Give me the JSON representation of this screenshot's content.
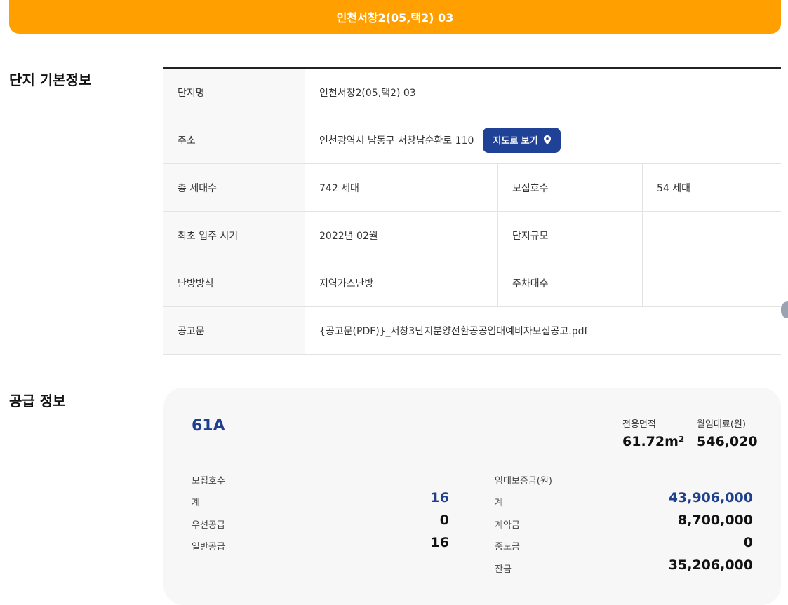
{
  "banner": {
    "title": "인천서창2(05,택2) 03"
  },
  "basic_info": {
    "section_title": "단지 기본정보",
    "rows": {
      "name": {
        "label": "단지명",
        "value": "인천서창2(05,택2) 03"
      },
      "address": {
        "label": "주소",
        "value": "인천광역시 남동구 서창남순환로 110",
        "map_button": "지도로 보기"
      },
      "households": {
        "label": "총 세대수",
        "value": "742 세대",
        "label2": "모집호수",
        "value2": "54 세대"
      },
      "move_in": {
        "label": "최초 입주 시기",
        "value": "2022년 02월",
        "label2": "단지규모",
        "value2": ""
      },
      "heating": {
        "label": "난방방식",
        "value": "지역가스난방",
        "label2": "주차대수",
        "value2": ""
      },
      "notice": {
        "label": "공고문",
        "value": "{공고문(PDF)}_서창3단지분양전환공공임대예비자모집공고.pdf"
      }
    }
  },
  "supply_info": {
    "section_title": "공급 정보",
    "type_name": "61A",
    "area_label": "전용면적",
    "area_value": "61.72m²",
    "rent_label": "월임대료(원)",
    "rent_value": "546,020",
    "recruit": {
      "title": "모집호수",
      "total_label": "계",
      "total_value": "16",
      "priority_label": "우선공급",
      "priority_value": "0",
      "general_label": "일반공급",
      "general_value": "16"
    },
    "deposit": {
      "title": "임대보증금(원)",
      "total_label": "계",
      "total_value": "43,906,000",
      "contract_label": "계약금",
      "contract_value": "8,700,000",
      "middle_label": "중도금",
      "middle_value": "0",
      "balance_label": "잔금",
      "balance_value": "35,206,000"
    }
  },
  "colors": {
    "banner": "#ffa000",
    "primary_blue": "#1f4196",
    "accent_text": "#1f3f8f"
  }
}
